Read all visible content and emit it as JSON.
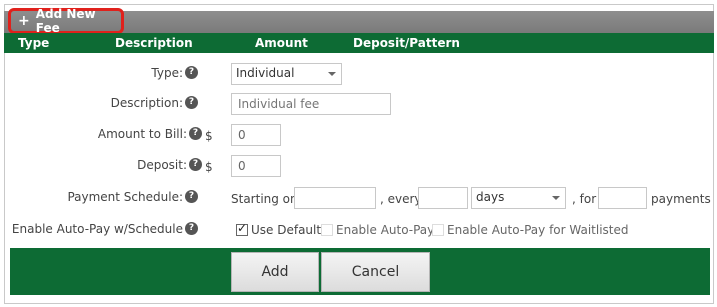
{
  "toolbar": {
    "add_label": "Add New Fee"
  },
  "table_header": {
    "columns": [
      "Type",
      "Description",
      "Amount",
      "Deposit/Pattern"
    ]
  },
  "form": {
    "type": {
      "label": "Type:",
      "value": "Individual"
    },
    "description": {
      "label": "Description:",
      "placeholder": "Individual fee"
    },
    "amount": {
      "label": "Amount to Bill:",
      "currency": "$",
      "value": "0"
    },
    "deposit": {
      "label": "Deposit:",
      "currency": "$",
      "value": "0"
    },
    "schedule": {
      "label": "Payment Schedule:",
      "starting_on": "Starting on",
      "every": ", every",
      "unit": "days",
      "for": ", for",
      "payments": "payments"
    },
    "autopay": {
      "label": "Enable Auto-Pay w/Schedule",
      "use_default": "Use Default",
      "use_default_checked": true,
      "enable_autopay": "Enable Auto-Pay",
      "enable_autopay_waitlisted": "Enable Auto-Pay for Waitlisted"
    }
  },
  "buttons": {
    "add": "Add",
    "cancel": "Cancel"
  },
  "colors": {
    "header_green": "#0d6b34",
    "highlight_red": "#e0211c",
    "topbar_gray": "#808080"
  }
}
